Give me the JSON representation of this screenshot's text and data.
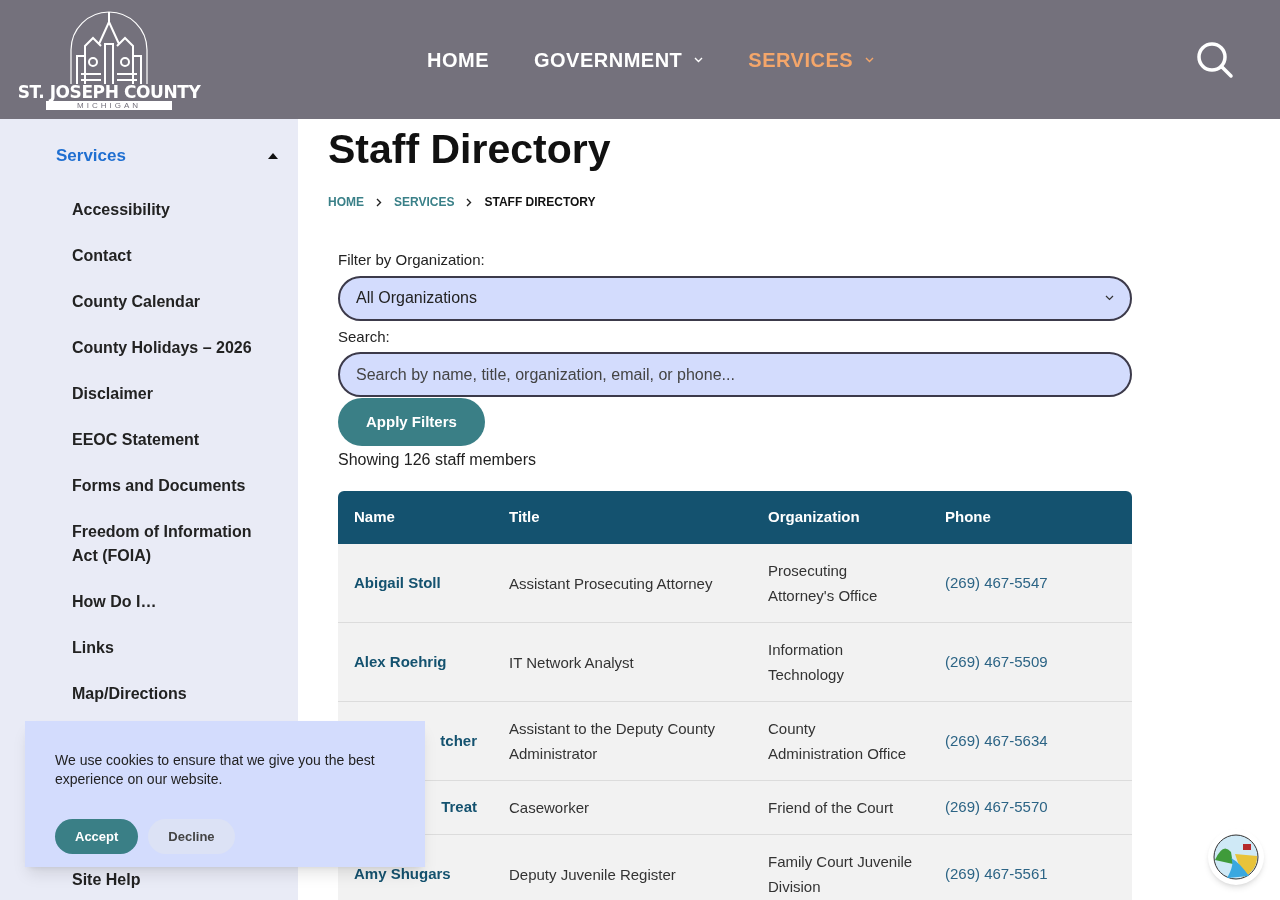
{
  "header": {
    "logo": {
      "name": "ST. JOSEPH COUNTY",
      "sub": "MICHIGAN"
    },
    "nav": [
      {
        "label": "HOME",
        "selected": false,
        "dropdown": false
      },
      {
        "label": "GOVERNMENT",
        "selected": false,
        "dropdown": true
      },
      {
        "label": "SERVICES",
        "selected": true,
        "dropdown": true
      }
    ]
  },
  "sidebar": {
    "title": "Services",
    "expanded": true,
    "items": [
      {
        "label": "Accessibility"
      },
      {
        "label": "Contact"
      },
      {
        "label": "County Calendar"
      },
      {
        "label": "County Holidays – 2026"
      },
      {
        "label": "Disclaimer"
      },
      {
        "label": "EEOC Statement"
      },
      {
        "label": "Forms and Documents"
      },
      {
        "label": "Freedom of Information Act (FOIA)"
      },
      {
        "label": "How Do I…"
      },
      {
        "label": "Links"
      },
      {
        "label": "Map/Directions"
      },
      {
        "label": "Site Help"
      }
    ]
  },
  "page": {
    "title": "Staff Directory",
    "breadcrumb": [
      {
        "label": "HOME",
        "current": false
      },
      {
        "label": "SERVICES",
        "current": false
      },
      {
        "label": "STAFF DIRECTORY",
        "current": true
      }
    ],
    "filter_label": "Filter by Organization:",
    "filter_value": "All Organizations",
    "search_label": "Search:",
    "search_placeholder": "Search by name, title, organization, email, or phone...",
    "apply_button": "Apply Filters",
    "count": "Showing 126 staff members"
  },
  "table": {
    "columns": [
      "Name",
      "Title",
      "Organization",
      "Phone"
    ],
    "rows": [
      {
        "name": "Abigail Stoll",
        "covered": false,
        "title": "Assistant Prosecuting Attorney",
        "organization": "Prosecuting Attorney's Office",
        "phone": "(269) 467-5547"
      },
      {
        "name": "Alex Roehrig",
        "covered": false,
        "title": "IT Network Analyst",
        "organization": "Information Technology",
        "phone": "(269) 467-5509"
      },
      {
        "name": "tcher",
        "covered": true,
        "title": "Assistant to the Deputy County Administrator",
        "organization": "County Administration Office",
        "phone": "(269) 467-5634"
      },
      {
        "name": "Treat",
        "covered": true,
        "title": "Caseworker",
        "organization": "Friend of the Court",
        "phone": "(269) 467-5570"
      },
      {
        "name": "Amy Shugars",
        "covered": false,
        "title": "Deputy Juvenile Register",
        "organization": "Family Court Juvenile Division",
        "phone": "(269) 467-5561"
      }
    ]
  },
  "cookie_banner": {
    "text": "We use cookies to ensure that we give you the best experience on our website.",
    "accept": "Accept",
    "decline": "Decline"
  }
}
